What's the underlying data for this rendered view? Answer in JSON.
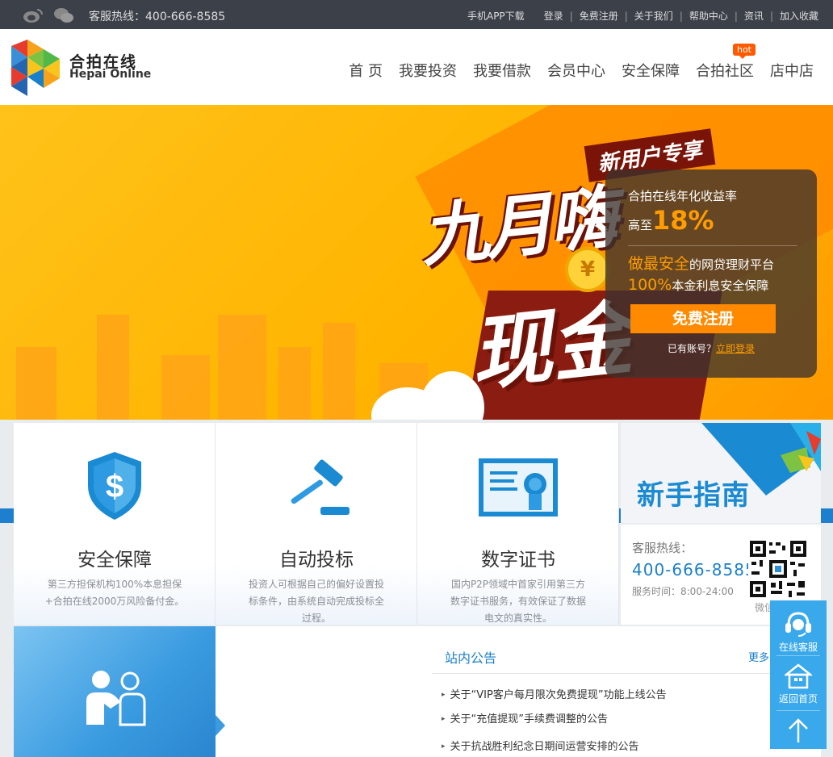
{
  "topbar": {
    "hotline": "客服热线：400-666-8585",
    "app_download": "手机APP下载",
    "links": [
      "登录",
      "免费注册",
      "关于我们",
      "帮助中心",
      "资讯",
      "加入收藏"
    ]
  },
  "header": {
    "logo_cn": "合拍在线",
    "logo_en": "Hepai Online",
    "nav": [
      "首 页",
      "我要投资",
      "我要借款",
      "会员中心",
      "安全保障",
      "合拍社区",
      "店中店"
    ],
    "hot_badge": "hot"
  },
  "banner": {
    "ribbon": "新用户专享",
    "headline1": "九月嗨",
    "headline2": "现金",
    "coin": "¥",
    "promo": {
      "line1": "合拍在线年化收益率",
      "line2_prefix": "高至",
      "line2_rate": "18%",
      "line3_highlight": "做最安全",
      "line3_rest": "的网贷理财平台",
      "line4_highlight": "100%",
      "line4_rest": "本金利息安全保障",
      "register_button": "免费注册",
      "login_prompt": "已有账号？",
      "login_link": "立即登录"
    }
  },
  "features": [
    {
      "title": "安全保障",
      "desc": "第三方担保机构100%本息担保+合拍在线2000万风险备付金。"
    },
    {
      "title": "自动投标",
      "desc": "投资人可根据自己的偏好设置投标条件，由系统自动完成投标全过程。"
    },
    {
      "title": "数字证书",
      "desc": "国内P2P领域中首家引用第三方数字证书服务，有效保证了数据电文的真实性。"
    }
  ],
  "guide": {
    "title": "新手指南"
  },
  "contact": {
    "label": "客服热线：",
    "number": "400-666-8585",
    "hours": "服务时间：8:00-24:00",
    "wechat": "微信"
  },
  "notice": {
    "title": "站内公告",
    "more": "更多",
    "items": [
      "关于“VIP客户每月限次免费提现”功能上线公告",
      "关于“充值提现”手续费调整的公告",
      "关于抗战胜利纪念日期间运营安排的公告"
    ]
  },
  "side_panel": {
    "service": "在线客服",
    "home": "返回首页"
  },
  "colors": {
    "topbar_bg": "#3c4049",
    "brand_blue": "#1a7fc9",
    "accent_orange": "#ff8a00",
    "banner_yellow": "#ffc21a"
  }
}
